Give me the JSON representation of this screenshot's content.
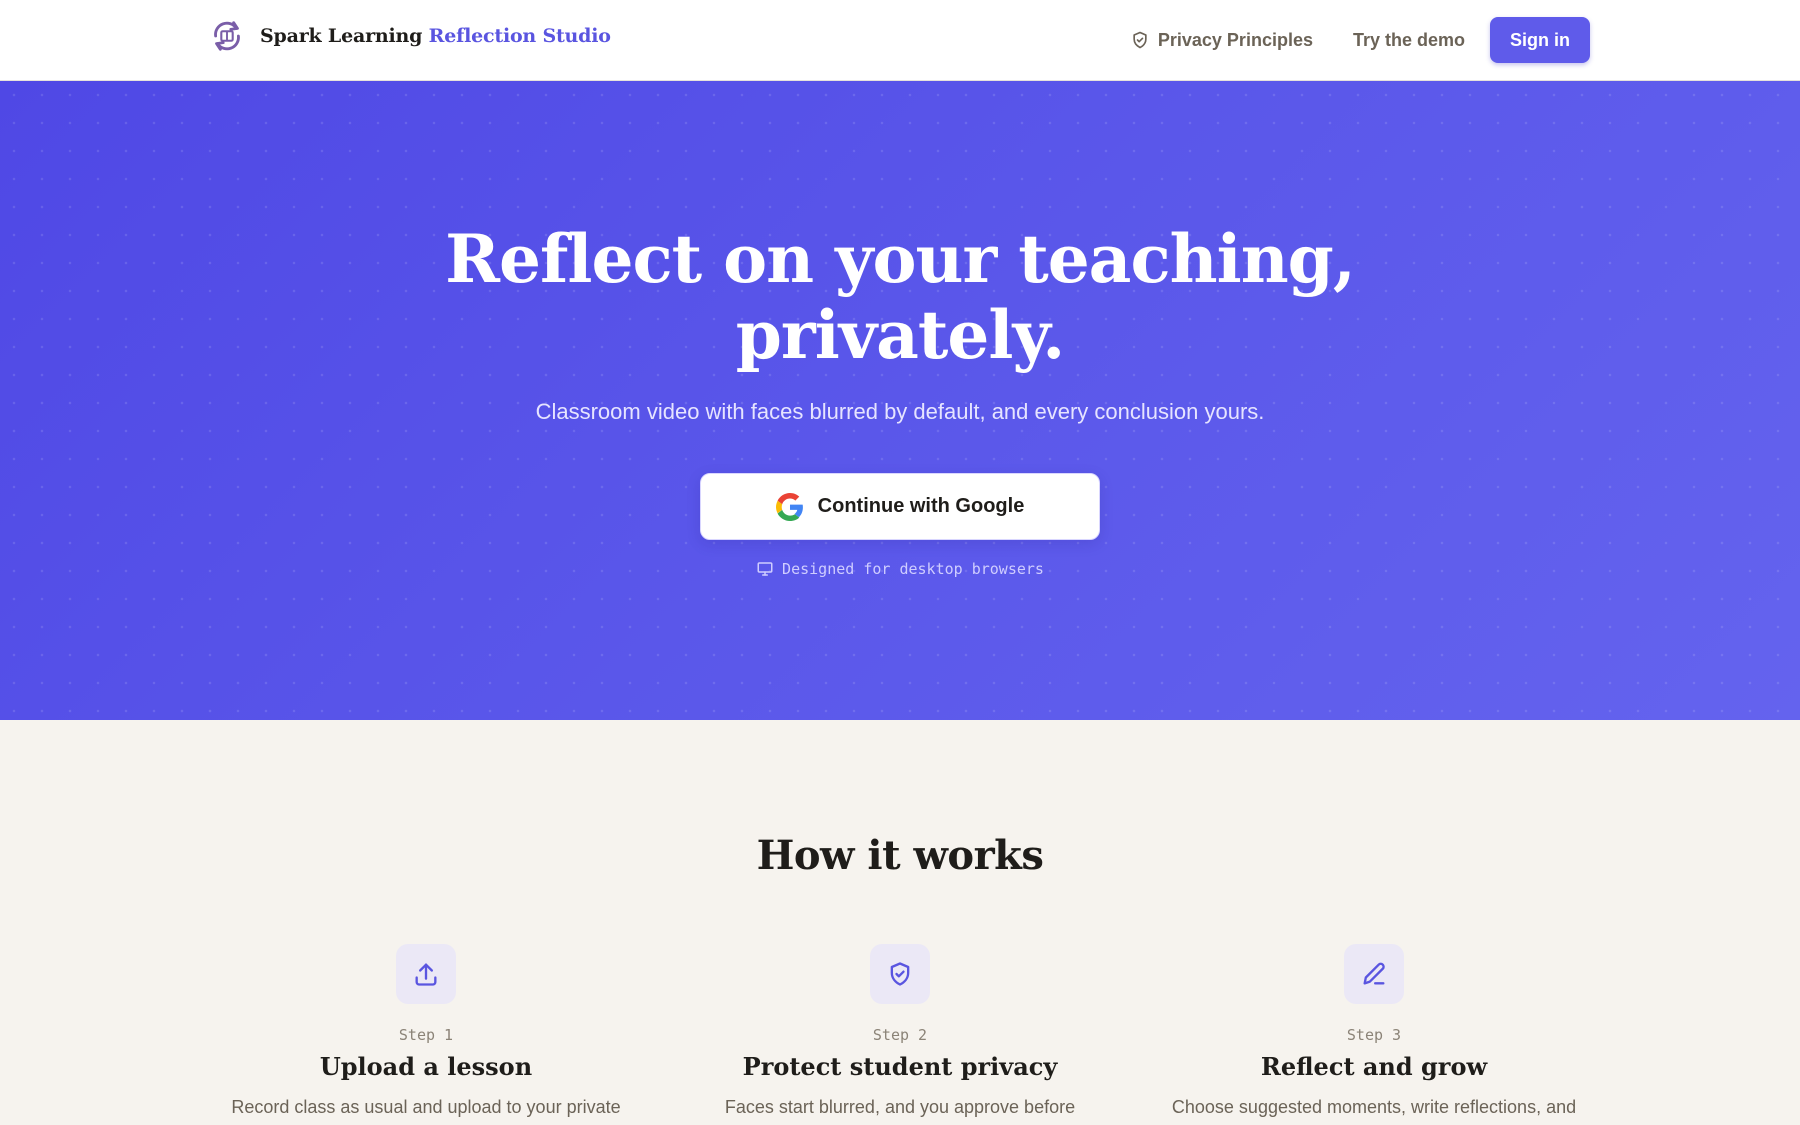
{
  "header": {
    "brand_primary": "Spark Learning",
    "brand_accent": "Reflection Studio",
    "nav": {
      "privacy_label": "Privacy Principles",
      "demo_label": "Try the demo",
      "signin_label": "Sign in"
    }
  },
  "hero": {
    "title_line1": "Reflect on your teaching,",
    "title_line2": "privately.",
    "subtitle": "Classroom video with faces blurred by default, and every conclusion yours.",
    "cta_label": "Continue with Google",
    "note": "Designed for desktop browsers"
  },
  "how_it_works": {
    "title": "How it works",
    "steps": [
      {
        "icon": "upload-icon",
        "label": "Step 1",
        "title": "Upload a lesson",
        "description": "Record class as usual and upload to your private"
      },
      {
        "icon": "shield-check-icon",
        "label": "Step 2",
        "title": "Protect student privacy",
        "description": "Faces start blurred, and you approve before"
      },
      {
        "icon": "pencil-icon",
        "label": "Step 3",
        "title": "Reflect and grow",
        "description": "Choose suggested moments, write reflections, and"
      }
    ]
  },
  "colors": {
    "accent": "#5f5bea",
    "hero_gradient_start": "#4f48e5",
    "hero_gradient_end": "#6463ee",
    "page_background": "#f6f3ee",
    "step_icon_background": "#ebe8f6"
  }
}
